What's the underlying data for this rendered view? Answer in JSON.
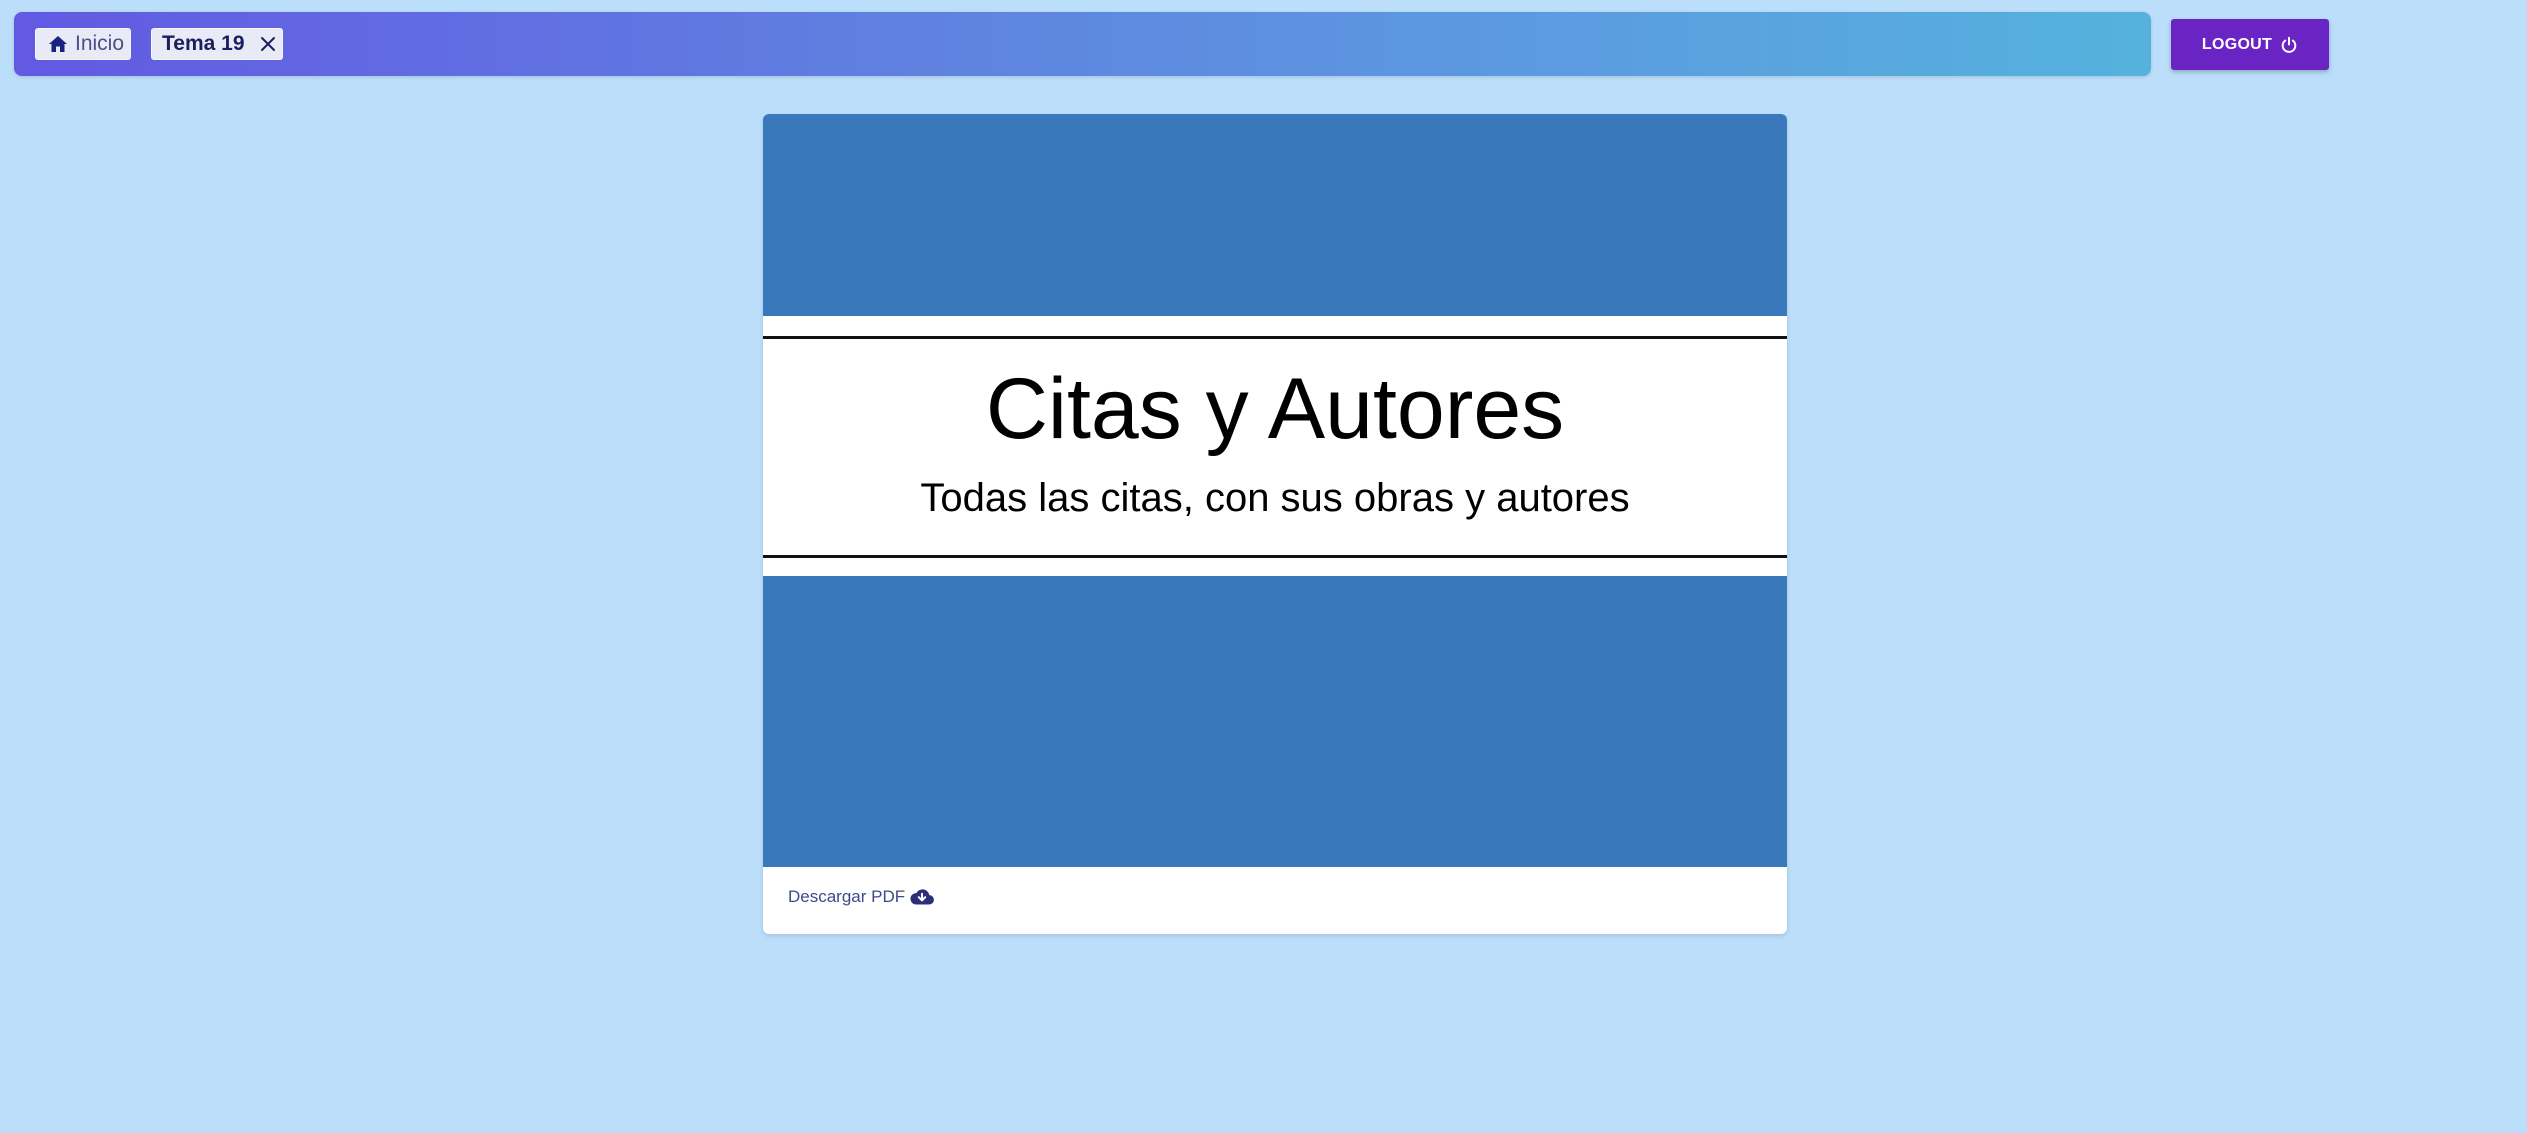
{
  "nav": {
    "home_label": "Inicio",
    "tab_label": "Tema 19"
  },
  "logout": {
    "label": "LOGOUT"
  },
  "document": {
    "title": "Citas y Autores",
    "subtitle": "Todas las citas, con sus obras y autores",
    "download_label": "Descargar PDF"
  },
  "icons": {
    "home": "home-icon",
    "close": "close-icon",
    "power": "power-icon",
    "download": "cloud-download-icon"
  },
  "colors": {
    "page_background": "#bbdefb",
    "topbar_gradient_start": "#6359e3",
    "topbar_gradient_end": "#55b2dd",
    "logout_button": "#6a24c4",
    "cover_blue": "#3a78bc",
    "link_color": "#3f4a8a"
  }
}
